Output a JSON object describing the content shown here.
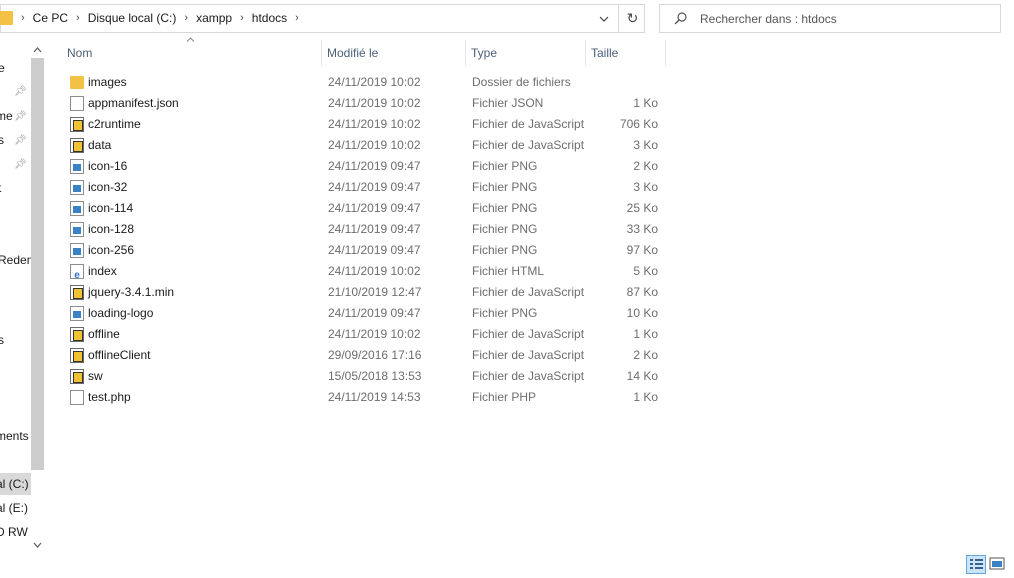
{
  "address_bar": {
    "crumbs": [
      "Ce PC",
      "Disque local (C:)",
      "xampp",
      "htdocs"
    ],
    "separator": "›",
    "dropdown_icon": "chevron-down-icon",
    "refresh_icon": "refresh-icon"
  },
  "search": {
    "placeholder": "Rechercher dans : htdocs"
  },
  "nav_pane": {
    "items": [
      {
        "label": "e"
      },
      {
        "label": "me"
      },
      {
        "label": "s"
      },
      {
        "label": "t"
      },
      {
        "label": "Redem"
      },
      {
        "label": "s"
      },
      {
        "label": "ments"
      },
      {
        "label": "al (C:)"
      },
      {
        "label": "al (E:)"
      },
      {
        "label": "D RW"
      }
    ]
  },
  "columns": {
    "name": "Nom",
    "date": "Modifié le",
    "type": "Type",
    "size": "Taille"
  },
  "files": [
    {
      "name": "images",
      "date": "24/11/2019 10:02",
      "type": "Dossier de fichiers",
      "size": "",
      "icon": "folder"
    },
    {
      "name": "appmanifest.json",
      "date": "24/11/2019 10:02",
      "type": "Fichier JSON",
      "size": "1 Ko",
      "icon": "file"
    },
    {
      "name": "c2runtime",
      "date": "24/11/2019 10:02",
      "type": "Fichier de JavaScript",
      "size": "706 Ko",
      "icon": "js"
    },
    {
      "name": "data",
      "date": "24/11/2019 10:02",
      "type": "Fichier de JavaScript",
      "size": "3 Ko",
      "icon": "js"
    },
    {
      "name": "icon-16",
      "date": "24/11/2019 09:47",
      "type": "Fichier PNG",
      "size": "2 Ko",
      "icon": "png"
    },
    {
      "name": "icon-32",
      "date": "24/11/2019 09:47",
      "type": "Fichier PNG",
      "size": "3 Ko",
      "icon": "png"
    },
    {
      "name": "icon-114",
      "date": "24/11/2019 09:47",
      "type": "Fichier PNG",
      "size": "25 Ko",
      "icon": "png"
    },
    {
      "name": "icon-128",
      "date": "24/11/2019 09:47",
      "type": "Fichier PNG",
      "size": "33 Ko",
      "icon": "png"
    },
    {
      "name": "icon-256",
      "date": "24/11/2019 09:47",
      "type": "Fichier PNG",
      "size": "97 Ko",
      "icon": "png"
    },
    {
      "name": "index",
      "date": "24/11/2019 10:02",
      "type": "Fichier HTML",
      "size": "5 Ko",
      "icon": "html"
    },
    {
      "name": "jquery-3.4.1.min",
      "date": "21/10/2019 12:47",
      "type": "Fichier de JavaScript",
      "size": "87 Ko",
      "icon": "js"
    },
    {
      "name": "loading-logo",
      "date": "24/11/2019 09:47",
      "type": "Fichier PNG",
      "size": "10 Ko",
      "icon": "png"
    },
    {
      "name": "offline",
      "date": "24/11/2019 10:02",
      "type": "Fichier de JavaScript",
      "size": "1 Ko",
      "icon": "js"
    },
    {
      "name": "offlineClient",
      "date": "29/09/2016 17:16",
      "type": "Fichier de JavaScript",
      "size": "2 Ko",
      "icon": "js"
    },
    {
      "name": "sw",
      "date": "15/05/2018 13:53",
      "type": "Fichier de JavaScript",
      "size": "14 Ko",
      "icon": "js"
    },
    {
      "name": "test.php",
      "date": "24/11/2019 14:53",
      "type": "Fichier PHP",
      "size": "1 Ko",
      "icon": "file"
    }
  ],
  "colors": {
    "folder": "#f3c245",
    "header_text": "#4c607a",
    "selected_view": "#cce4f7"
  }
}
